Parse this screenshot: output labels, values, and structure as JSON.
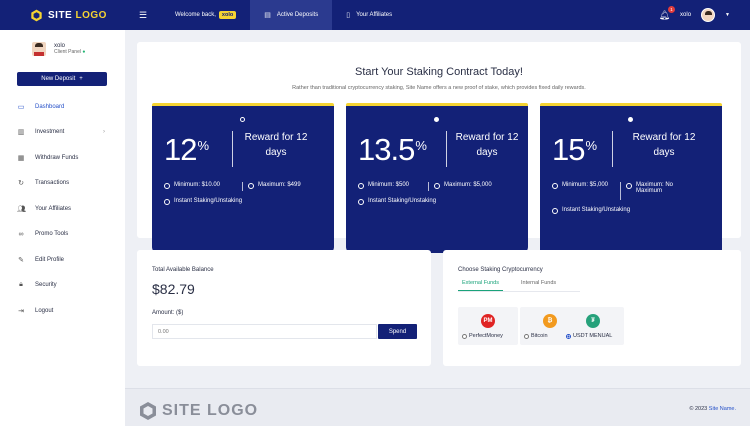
{
  "brand": {
    "logo_word1": "SITE",
    "logo_word2": "LOGO"
  },
  "topbar": {
    "welcome_text": "Welcome back,",
    "welcome_user": "xolo",
    "nav": [
      {
        "label": "Active Deposits",
        "icon": "deposit-icon",
        "active": true
      },
      {
        "label": "Your Affiliates",
        "icon": "document-icon",
        "active": false
      }
    ],
    "notification_count": "1",
    "username": "xolo"
  },
  "sidebar": {
    "profile_name": "xolo",
    "profile_role": "Client Panel",
    "new_deposit_label": "New Deposit",
    "items": [
      {
        "label": "Dashboard",
        "icon": "monitor-icon",
        "active": true
      },
      {
        "label": "Investment",
        "icon": "chart-icon",
        "has_submenu": true
      },
      {
        "label": "Withdraw Funds",
        "icon": "wallet-icon"
      },
      {
        "label": "Transactions",
        "icon": "history-icon"
      },
      {
        "label": "Your Affiliates",
        "icon": "users-icon"
      },
      {
        "label": "Promo Tools",
        "icon": "link-icon"
      },
      {
        "label": "Edit Profile",
        "icon": "edit-icon"
      },
      {
        "label": "Security",
        "icon": "lock-icon"
      },
      {
        "label": "Logout",
        "icon": "logout-icon"
      }
    ]
  },
  "staking": {
    "title": "Start Your Staking Contract Today!",
    "subtitle": "Rather than traditional cryptocurrency staking, Site Name offers a new proof of stake, which provides fixed daily rewards.",
    "plans": [
      {
        "rate": "12",
        "unit": "%",
        "reward": "Reward for 12 days",
        "minimum": "Minimum: $10.00",
        "maximum": "Maximum: $499",
        "feature": "Instant Staking/Unstaking"
      },
      {
        "rate": "13.5",
        "unit": "%",
        "reward": "Reward for 12 days",
        "minimum": "Minimum: $500",
        "maximum": "Maximum: $5,000",
        "feature": "Instant Staking/Unstaking"
      },
      {
        "rate": "15",
        "unit": "%",
        "reward": "Reward for 12 days",
        "minimum": "Minimum: $5,000",
        "maximum": "Maximum: No Maximum",
        "feature": "Instant Staking/Unstaking"
      }
    ]
  },
  "balance": {
    "label": "Total Available Balance",
    "value": "$82.79",
    "amount_label": "Amount: ($)",
    "amount_value": "0.00",
    "spend_label": "Spend"
  },
  "crypto": {
    "title": "Choose Staking Cryptocurrency",
    "tabs": [
      {
        "label": "External Funds",
        "active": true
      },
      {
        "label": "Internal Funds",
        "active": false
      }
    ],
    "options": [
      {
        "label": "PerfectMoney",
        "icon": "perfectmoney-icon",
        "logo_text": "PM",
        "color": "#e02424",
        "selected": false
      },
      {
        "label": "Bitcoin",
        "icon": "bitcoin-icon",
        "logo_text": "₿",
        "color": "#f29a1f",
        "selected": false
      },
      {
        "label": "USDT MENUAL",
        "icon": "tether-icon",
        "logo_text": "₮",
        "color": "#26a17b",
        "selected": true
      }
    ]
  },
  "footer": {
    "logo_word1": "SITE",
    "logo_word2": "LOGO",
    "copyright": "© 2023",
    "site_name": "Site Name."
  },
  "colors": {
    "primary": "#132177",
    "accent": "#f5d432",
    "link": "#2550c8",
    "success": "#1aa37a"
  }
}
